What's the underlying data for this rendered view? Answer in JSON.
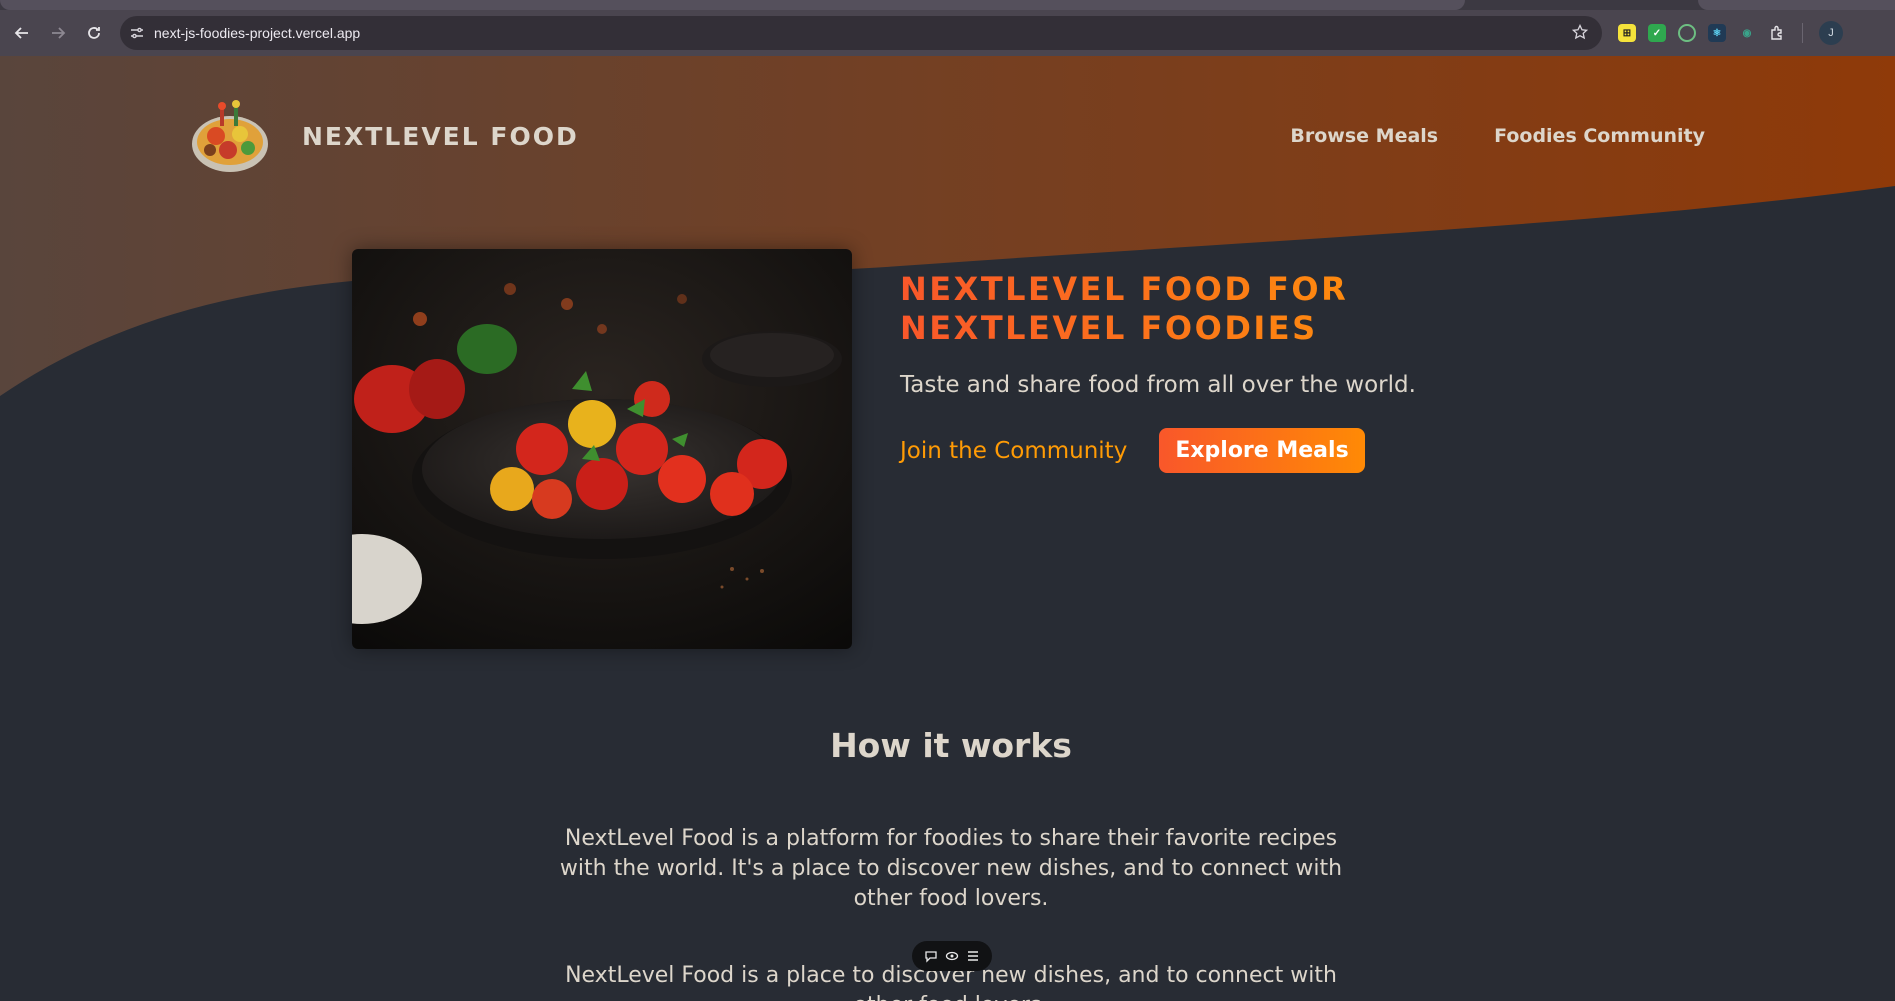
{
  "browser": {
    "url": "next-js-foodies-project.vercel.app",
    "profile_initial": "J",
    "extensions": [
      {
        "name": "extension-1-icon",
        "label": ""
      },
      {
        "name": "extension-2-icon",
        "label": ""
      },
      {
        "name": "extension-3-icon",
        "label": ""
      },
      {
        "name": "react-devtools-icon",
        "label": ""
      },
      {
        "name": "extension-5-icon",
        "label": ""
      }
    ]
  },
  "header": {
    "logo_text": "NextLevel Food",
    "nav": [
      {
        "label": "Browse Meals"
      },
      {
        "label": "Foodies Community"
      }
    ]
  },
  "hero": {
    "title": "NextLevel Food for NextLevel Foodies",
    "subtitle": "Taste and share food from all over the world.",
    "community_link": "Join the Community",
    "explore_button": "Explore Meals"
  },
  "how_it_works": {
    "title": "How it works",
    "paragraph_1": "NextLevel Food is a platform for foodies to share their favorite recipes with the world. It's a place to discover new dishes, and to connect with other food lovers.",
    "paragraph_2": "NextLevel Food is a place to discover new dishes, and to connect with other food lovers."
  },
  "colors": {
    "page_background": "#282c34",
    "accent_orange": "#ff9b05",
    "accent_red": "#f9572a",
    "header_brown": "#8a3c0c",
    "text": "#ddd6cb"
  }
}
